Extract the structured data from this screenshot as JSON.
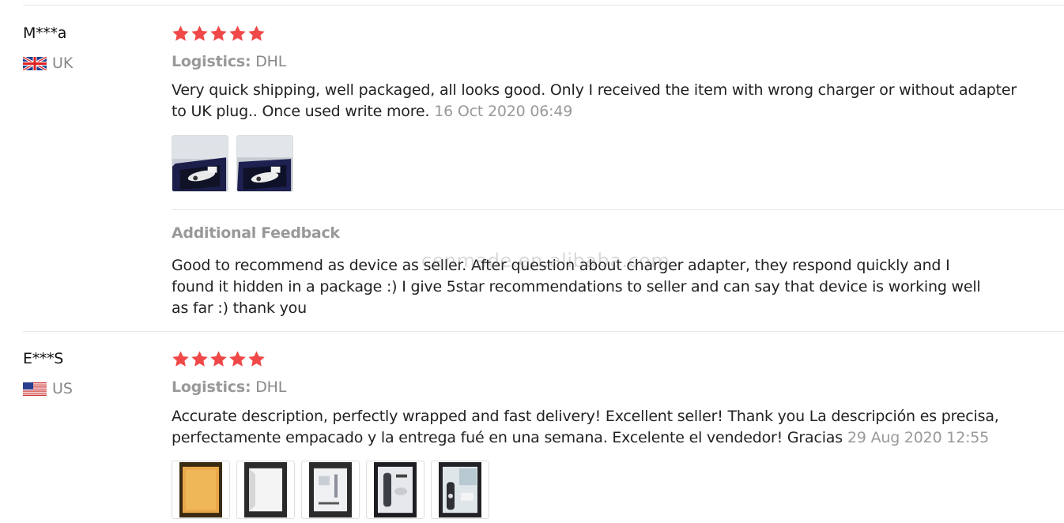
{
  "reviews": [
    {
      "user": "M***a",
      "country": "UK",
      "flag_icon": "uk-flag-icon",
      "stars": 5,
      "logistics_label": "Logistics:",
      "logistics_value": "DHL",
      "text": "Very quick shipping, well packaged, all looks good. Only I received the item with wrong charger or without adapter to UK plug.. Once used write more.",
      "date": "16 Oct 2020 06:49",
      "photo_count": 2,
      "additional_feedback_title": "Additional Feedback",
      "additional_feedback_text": "Good to recommend as device as seller. After question about charger adapter, they respond quickly and I found it hidden in a package :) I give 5star recommendations to seller and can say that device is working well as far :) thank you"
    },
    {
      "user": "E***S",
      "country": "US",
      "flag_icon": "us-flag-icon",
      "stars": 5,
      "logistics_label": "Logistics:",
      "logistics_value": "DHL",
      "text": "Accurate description, perfectly wrapped and fast delivery! Excellent seller! Thank you La descripción es precisa, perfectamente empacado y la entrega fué en una semana. Excelente el vendedor! Gracias",
      "date": "29 Aug 2020 12:55",
      "photo_count": 5
    }
  ],
  "watermark": "cenmade.en.alibaba.com",
  "colors": {
    "star": "#f04848",
    "muted": "#999999",
    "divider": "#e6e6e6"
  }
}
